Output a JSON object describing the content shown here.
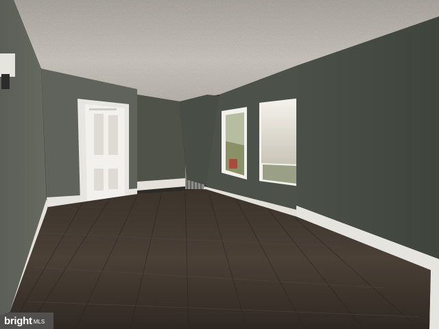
{
  "photo": {
    "subject": "empty-room-interior",
    "colors": {
      "ceiling": "#b9b4ad",
      "wall_left": "#5c6058",
      "wall_back": "#52564f",
      "wall_right": "#454a42",
      "floor": "#3a3129",
      "baseboard": "#e8e6e0",
      "door": "#f2f1ed"
    }
  },
  "watermark": {
    "brand": "bright",
    "suffix": "MLS"
  }
}
